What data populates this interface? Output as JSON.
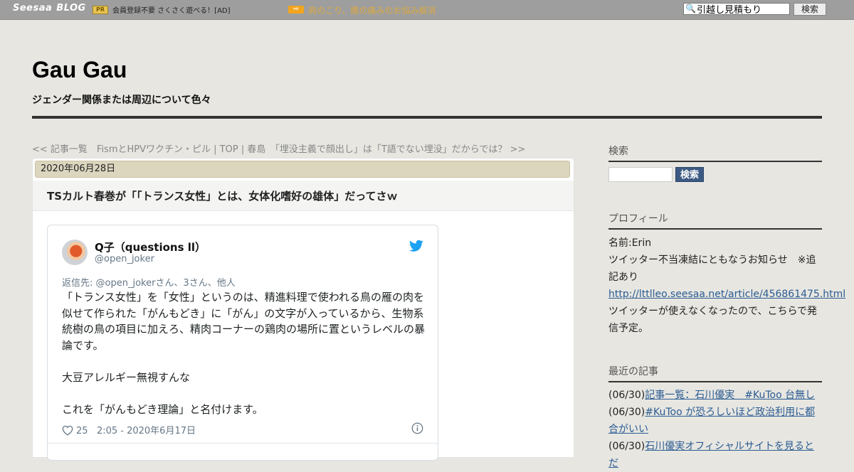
{
  "topbar": {
    "logo_main": "Seesaa",
    "logo_sub": "BLOG",
    "pr_badge": "PR",
    "pr_text": "会員登録不要 さくさく遊べる！[AD]",
    "arrow_badge": "⇨",
    "ad_link": "肩のこり、腰の痛みのお悩み解消",
    "search_value": "引越し見積もり",
    "search_button": "検索"
  },
  "header": {
    "title": "Gau Gau",
    "description": "ジェンダー関係または周辺について色々"
  },
  "article_nav": {
    "prev": "<< 記事一覧　FismとHPVワクチン・ピル",
    "sep1": " | ",
    "top": "TOP",
    "sep2": " | ",
    "next": "春島　「埋没主義で顔出し」は「T語でない埋没」だからでは？ >>"
  },
  "post": {
    "date": "2020年06月28日",
    "title": "TSカルト春巻が「「トランス女性」とは、女体化嗜好の雄体」だってさｗ"
  },
  "tweet": {
    "name": "Q子（questions ll）",
    "handle": "@open_joker",
    "reply_to": "返信先: @open_jokerさん、3さん、他人",
    "body": "「トランス女性」を「女性」というのは、精進料理で使われる鳥の雁の肉を似せて作られた「がんもどき」に「がん」の文字が入っているから、生物系統樹の鳥の項目に加えろ、精肉コーナーの鶏肉の場所に置というレベルの暴論です。\n\n大豆アレルギー無視すんな\n\nこれを「がんもどき理論」と名付けます。",
    "likes": "25",
    "timestamp": "2:05 - 2020年6月17日"
  },
  "sidebar": {
    "search_heading": "検索",
    "search_button": "検索",
    "profile_heading": "プロフィール",
    "profile_name": "名前:Erin",
    "profile_note": "ツイッター不当凍結にともなうお知らせ　※追記あり",
    "profile_link": "http://lttlleo.seesaa.net/article/456861475.html",
    "profile_extra": "ツイッターが使えなくなったので、こちらで発信予定。",
    "recent_heading": "最近の記事",
    "recent": [
      {
        "date": "(06/30)",
        "title": "記事一覧：石川優実　#KuToo 台無し"
      },
      {
        "date": "(06/30)",
        "title": "#KuToo が恐ろしいほど政治利用に都合がいい"
      },
      {
        "date": "(06/30)",
        "title": "石川優実オフィシャルサイトを見るとだ"
      }
    ]
  },
  "colors": {
    "page_bg": "#e7e6e1",
    "topbar_bg": "#9e9e9e",
    "date_bar": "#dcd6bf",
    "link": "#2b5c92",
    "twitter_blue": "#1da1f2",
    "search_button": "#3c5a83"
  }
}
